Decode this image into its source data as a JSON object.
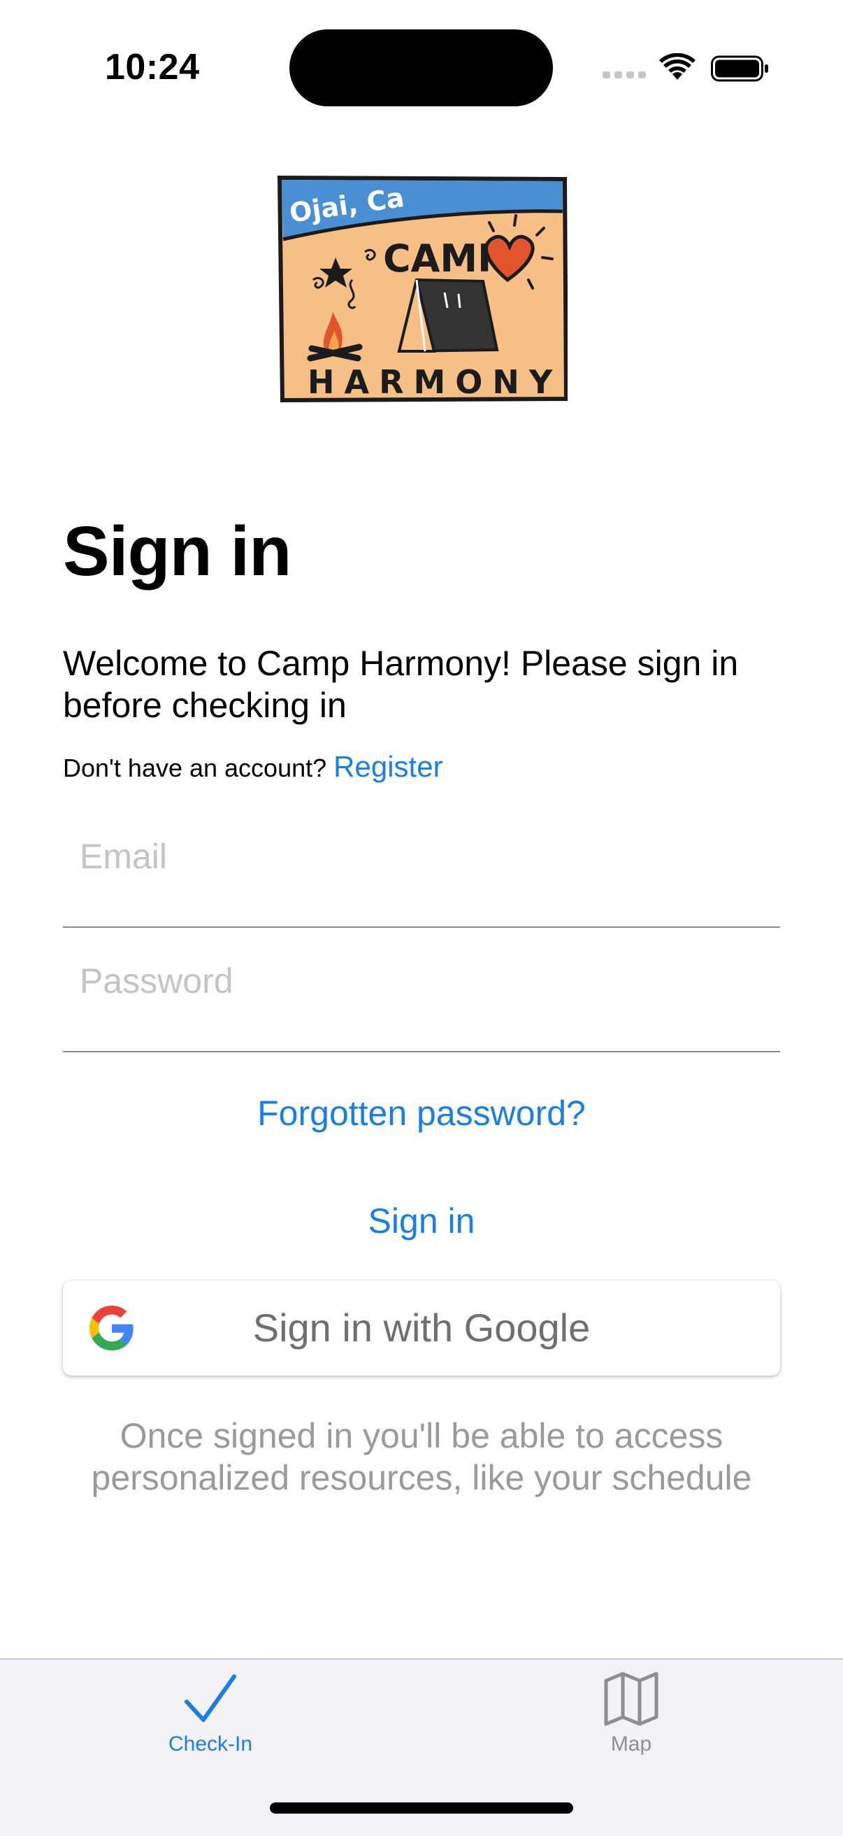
{
  "status_bar": {
    "time": "10:24"
  },
  "logo": {
    "location_text": "Ojai, Ca",
    "camp_text": "CAMP",
    "name_text": "HARMONY"
  },
  "sign_in": {
    "title": "Sign in",
    "welcome": "Welcome to Camp Harmony! Please sign in before checking in",
    "no_account_text": "Don't have an account?",
    "register_label": "Register",
    "email_placeholder": "Email",
    "password_placeholder": "Password",
    "forgot_label": "Forgotten password?",
    "sign_in_label": "Sign in",
    "google_label": "Sign in with Google",
    "info_text": "Once signed in you'll be able to access personalized resources, like your schedule"
  },
  "tab_bar": {
    "tabs": [
      {
        "label": "Check-In",
        "icon": "checkmark-icon",
        "selected": true
      },
      {
        "label": "Map",
        "icon": "map-icon",
        "selected": false
      }
    ]
  },
  "colors": {
    "accent": "#1a7ee6",
    "tab_inactive": "#8e8e93",
    "logo_sky": "#4a8fd4",
    "logo_sand": "#f6bf85",
    "logo_heart": "#e0552e"
  }
}
